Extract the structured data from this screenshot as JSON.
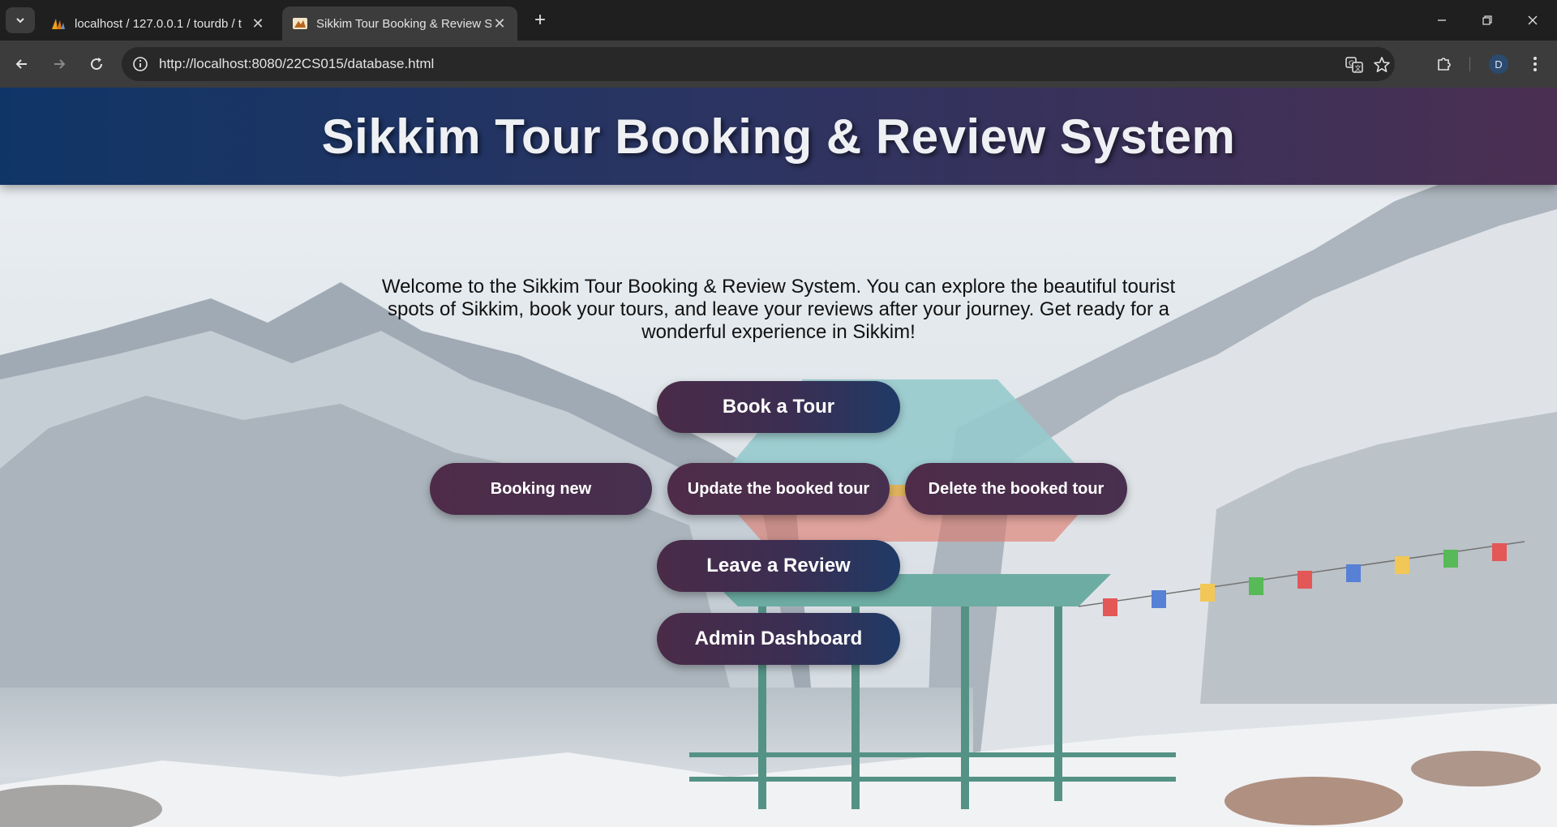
{
  "browser": {
    "tabs": [
      {
        "title": "localhost / 127.0.0.1 / tourdb / t",
        "active": false
      },
      {
        "title": "Sikkim Tour Booking & Review S",
        "active": true
      }
    ],
    "url": "http://localhost:8080/22CS015/database.html",
    "profile_initial": "D"
  },
  "header": {
    "title": "Sikkim Tour Booking & Review System"
  },
  "main": {
    "welcome_text": "Welcome to the Sikkim Tour Booking & Review System. You can explore the beautiful tourist spots of Sikkim, book your tours, and leave your reviews after your journey. Get ready for a wonderful experience in Sikkim!",
    "book_tour_label": "Book a Tour",
    "booking_new_label": "Booking new",
    "update_label": "Update the booked tour",
    "delete_label": "Delete the booked tour",
    "review_label": "Leave a Review",
    "admin_label": "Admin Dashboard"
  },
  "colors": {
    "header_start": "#0f3566",
    "header_end": "#4a2f52",
    "button_start": "#4a2b48",
    "button_end": "#1f3a66"
  }
}
